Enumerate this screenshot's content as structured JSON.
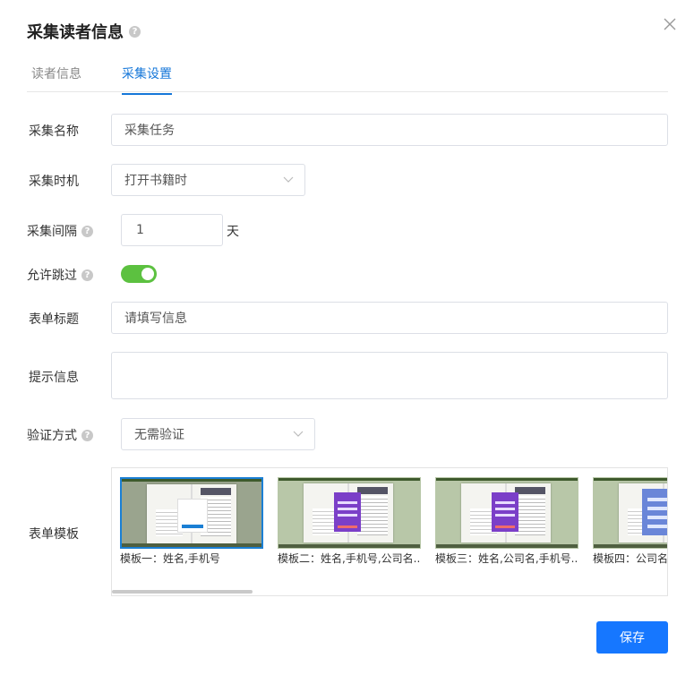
{
  "dialog": {
    "title": "采集读者信息"
  },
  "tabs": [
    {
      "label": "读者信息",
      "active": false
    },
    {
      "label": "采集设置",
      "active": true
    }
  ],
  "form": {
    "name_label": "采集名称",
    "name_value": "采集任务",
    "timing_label": "采集时机",
    "timing_value": "打开书籍时",
    "interval_label": "采集间隔",
    "interval_value": "1",
    "interval_unit": "天",
    "skip_label": "允许跳过",
    "skip_enabled": true,
    "form_title_label": "表单标题",
    "form_title_value": "请填写信息",
    "hint_label": "提示信息",
    "hint_value": "",
    "verify_label": "验证方式",
    "verify_value": "无需验证",
    "template_label": "表单模板"
  },
  "templates": [
    {
      "caption": "模板一：姓名,手机号",
      "selected": true
    },
    {
      "caption": "模板二：姓名,手机号,公司名...",
      "selected": false
    },
    {
      "caption": "模板三：姓名,公司名,手机号...",
      "selected": false
    },
    {
      "caption": "模板四：公司名",
      "selected": false
    }
  ],
  "buttons": {
    "save": "保存"
  },
  "colors": {
    "accent": "#1677ff",
    "switch_on": "#5cc140"
  },
  "icons": {
    "close": "close-icon",
    "help": "help-icon",
    "dropdown": "chevron-down-icon"
  }
}
